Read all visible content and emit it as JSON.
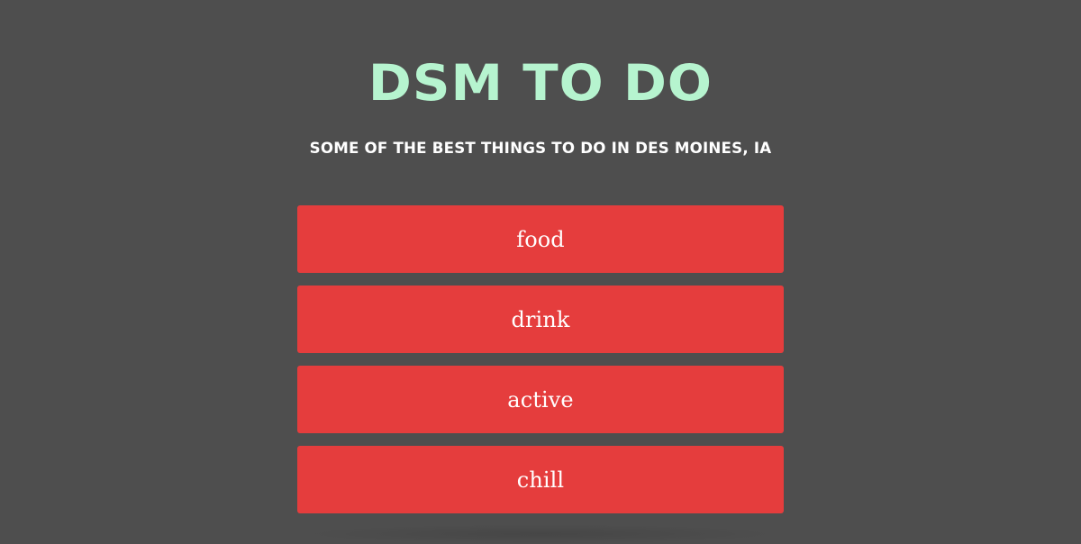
{
  "header": {
    "title": "DSM TO DO",
    "subtitle": "SOME OF THE BEST THINGS TO DO IN DES MOINES, IA"
  },
  "menu": {
    "items": [
      {
        "label": "food"
      },
      {
        "label": "drink"
      },
      {
        "label": "active"
      },
      {
        "label": "chill"
      }
    ]
  },
  "colors": {
    "background": "#4e4e4e",
    "title": "#b6f4cf",
    "subtitle": "#ffffff",
    "button": "#e53d3d",
    "button_text": "#ffffff"
  }
}
